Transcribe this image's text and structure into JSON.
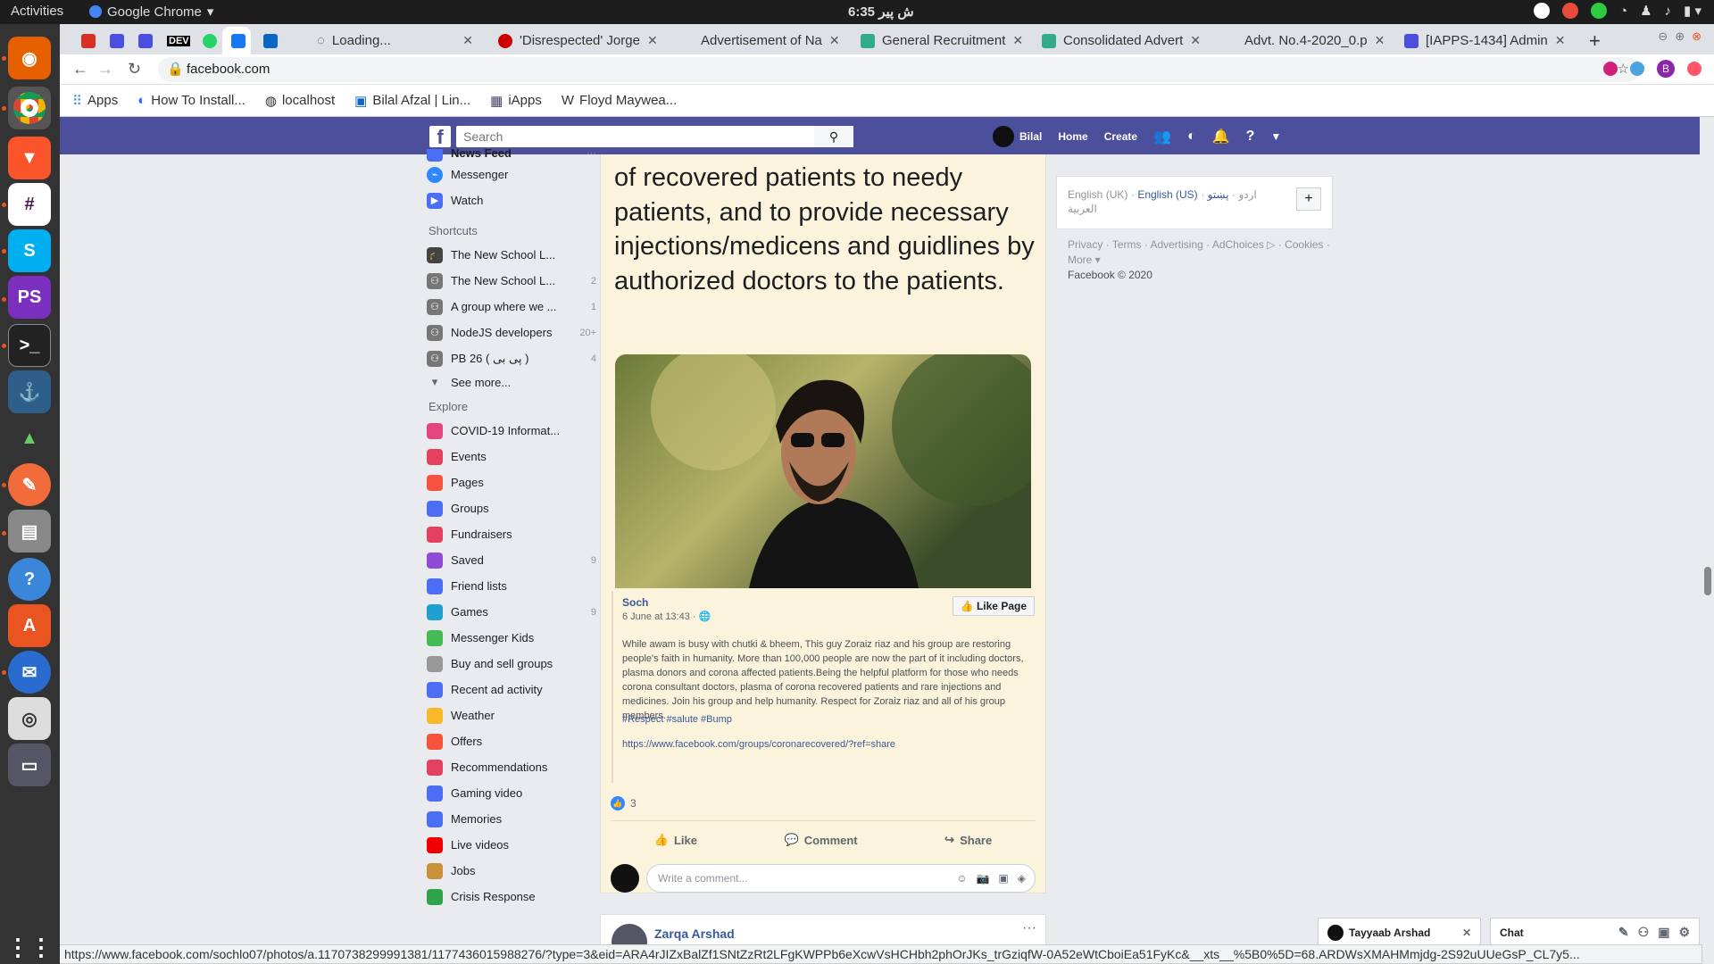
{
  "system": {
    "activities": "Activities",
    "app": "Google Chrome",
    "clock": "6:35 ش  پیر"
  },
  "tabs": [
    {
      "label": "",
      "color": "#d93025"
    },
    {
      "label": "",
      "color": "#4b4fe0"
    },
    {
      "label": "",
      "color": "#4b4fe0"
    },
    {
      "label": "DEV",
      "color": "#000"
    },
    {
      "label": "",
      "color": "#25d366"
    },
    {
      "label": "",
      "color": "#1877f2"
    },
    {
      "label": "",
      "color": "#0a66c2"
    },
    {
      "label": "Loading...",
      "color": "#999"
    },
    {
      "label": "'Disrespected' Jorge",
      "color": "#c00"
    },
    {
      "label": "Advertisement of Na",
      "color": "#fff"
    },
    {
      "label": "General Recruitment",
      "color": "#3a8"
    },
    {
      "label": "Consolidated Advert",
      "color": "#3a8"
    },
    {
      "label": "Advt. No.4-2020_0.p",
      "color": "#fff"
    },
    {
      "label": "[IAPPS-1434] Admin",
      "color": "#4b4fe0"
    }
  ],
  "omnibox": {
    "url": "facebook.com"
  },
  "bookmarks": [
    "Apps",
    "How To Install...",
    "localhost",
    "Bilal Afzal | Lin...",
    "iApps",
    "Floyd Maywea..."
  ],
  "fb": {
    "search_placeholder": "Search",
    "user": "Bilal",
    "home": "Home",
    "create": "Create"
  },
  "left": {
    "top": [
      {
        "label": "News Feed"
      },
      {
        "label": "Messenger"
      },
      {
        "label": "Watch"
      }
    ],
    "shortcuts_title": "Shortcuts",
    "shortcuts": [
      {
        "label": "The New School L...",
        "count": ""
      },
      {
        "label": "The New School L...",
        "count": "2"
      },
      {
        "label": "A group where we ...",
        "count": "1"
      },
      {
        "label": "NodeJS developers",
        "count": "20+"
      },
      {
        "label": "PB 26 ( پی بی )",
        "count": "4"
      }
    ],
    "see_more": "See more...",
    "explore_title": "Explore",
    "explore": [
      {
        "label": "COVID-19 Informat...",
        "count": "",
        "color": "#e4457d"
      },
      {
        "label": "Events",
        "count": "",
        "color": "#e4405f"
      },
      {
        "label": "Pages",
        "count": "",
        "color": "#f5533d"
      },
      {
        "label": "Groups",
        "count": "",
        "color": "#4b6ef5"
      },
      {
        "label": "Fundraisers",
        "count": "",
        "color": "#e4405f"
      },
      {
        "label": "Saved",
        "count": "9",
        "color": "#8d4bd6"
      },
      {
        "label": "Friend lists",
        "count": "",
        "color": "#4b6ef5"
      },
      {
        "label": "Games",
        "count": "9",
        "color": "#20a0d0"
      },
      {
        "label": "Messenger Kids",
        "count": "",
        "color": "#44bb55"
      },
      {
        "label": "Buy and sell groups",
        "count": "",
        "color": "#999"
      },
      {
        "label": "Recent ad activity",
        "count": "",
        "color": "#4b6ef5"
      },
      {
        "label": "Weather",
        "count": "",
        "color": "#f7b928"
      },
      {
        "label": "Offers",
        "count": "",
        "color": "#f5533d"
      },
      {
        "label": "Recommendations",
        "count": "",
        "color": "#e4405f"
      },
      {
        "label": "Gaming video",
        "count": "",
        "color": "#4b6ef5"
      },
      {
        "label": "Memories",
        "count": "",
        "color": "#4b6ef5"
      },
      {
        "label": "Live videos",
        "count": "",
        "color": "#e00"
      },
      {
        "label": "Jobs",
        "count": "",
        "color": "#c8913a"
      },
      {
        "label": "Crisis Response",
        "count": "",
        "color": "#31a24c"
      }
    ]
  },
  "post": {
    "big_text": "of recovered patients to needy patients, and to provide necessary injections/medicens and guidlines by authorized doctors to the patients.",
    "page": "Soch",
    "time": "6 June at 13:43 · ",
    "like_page": "Like Page",
    "body": "While awam is busy with chutki & bheem, This guy Zoraiz riaz and his group are restoring people's faith in humanity. More than 100,000 people are now the part of it including doctors, plasma donors and corona affected patients.Being the helpful platform for those who needs corona consultant doctors, plasma of corona recovered patients and rare injections and medicines. Join his group and help humanity. Respect for Zoraiz riaz and all of his group members.",
    "tags": "#Respect #salute #Bump",
    "link": "https://www.facebook.com/groups/coronarecovered/?ref=share",
    "likes": "3",
    "like": "Like",
    "comment": "Comment",
    "share": "Share",
    "comment_placeholder": "Write a comment..."
  },
  "post2": {
    "author": "Zarqa Arshad"
  },
  "right": {
    "lang_uk": "English (UK)",
    "lang_us": "English (US)",
    "lang_ur": "اردو",
    "lang_ps": "پښتو",
    "lang_ar": "العربية",
    "links": "Privacy · Terms · Advertising · AdChoices ▷ · Cookies · More ▾",
    "copyright": "Facebook © 2020"
  },
  "chat": {
    "contact": "Tayyaab Arshad",
    "title": "Chat"
  },
  "status_url": "https://www.facebook.com/sochlo07/photos/a.1170738299991381/1177436015988276/?type=3&eid=ARA4rJIZxBalZf1SNtZzRt2LFgKWPPb6eXcwVsHCHbh2phOrJKs_trGziqfW-0A52eWtCboiEa51FyKc&__xts__%5B0%5D=68.ARDWsXMAHMmjdg-2S92uUUeGsP_CL7y5..."
}
